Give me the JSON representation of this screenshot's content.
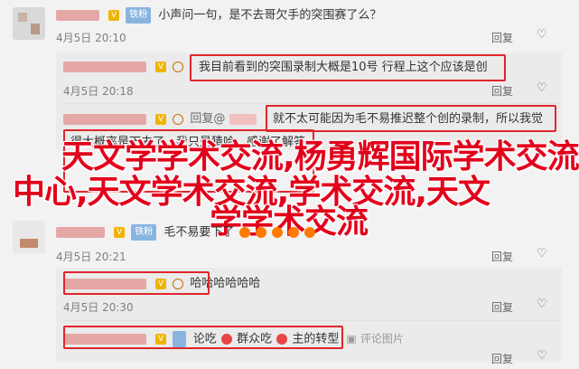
{
  "comments": [
    {
      "badge": "铁粉",
      "text": "小声问一句，是不去哥欠手的突围赛了么？",
      "time": "4月5日 20:10",
      "reply": "回复",
      "thumb": "♡"
    }
  ],
  "replies": [
    {
      "text": "我目前看到的突围录制大概是10号 行程上这个应该是创",
      "time": "4月5日 20:18",
      "reply": "回复",
      "thumb": "♡"
    },
    {
      "prefix": "回复@",
      "text": "就不太可能因为毛不易推迟整个创的录制，所以我觉",
      "time": "",
      "reply": "",
      "thumb": ""
    },
    {
      "text": "得大概率是下去了。我只是猜哈，感谢了解答",
      "time": "",
      "reply": "",
      "thumb": ""
    }
  ],
  "comment2": {
    "badge": "铁粉",
    "text": "毛不易要下了",
    "time": "4月5日 20:21",
    "reply": "回复",
    "thumb": "♡"
  },
  "reply_haha": {
    "text": "哈哈哈哈哈哈",
    "time": "4月5日 20:30",
    "reply": "回复",
    "thumb": "♡"
  },
  "reply_last": {
    "text_a": "论吃",
    "text_b": "群众吃",
    "text_c": "主的转型",
    "comment_link": "评论图片",
    "reply": "回复",
    "thumb": "♡"
  },
  "overlay": {
    "line1": "天文学学术交流,杨勇辉国际学术交流",
    "line2": "中心,天文学术交流,学术交流,天文",
    "line3": "学学术交流"
  }
}
